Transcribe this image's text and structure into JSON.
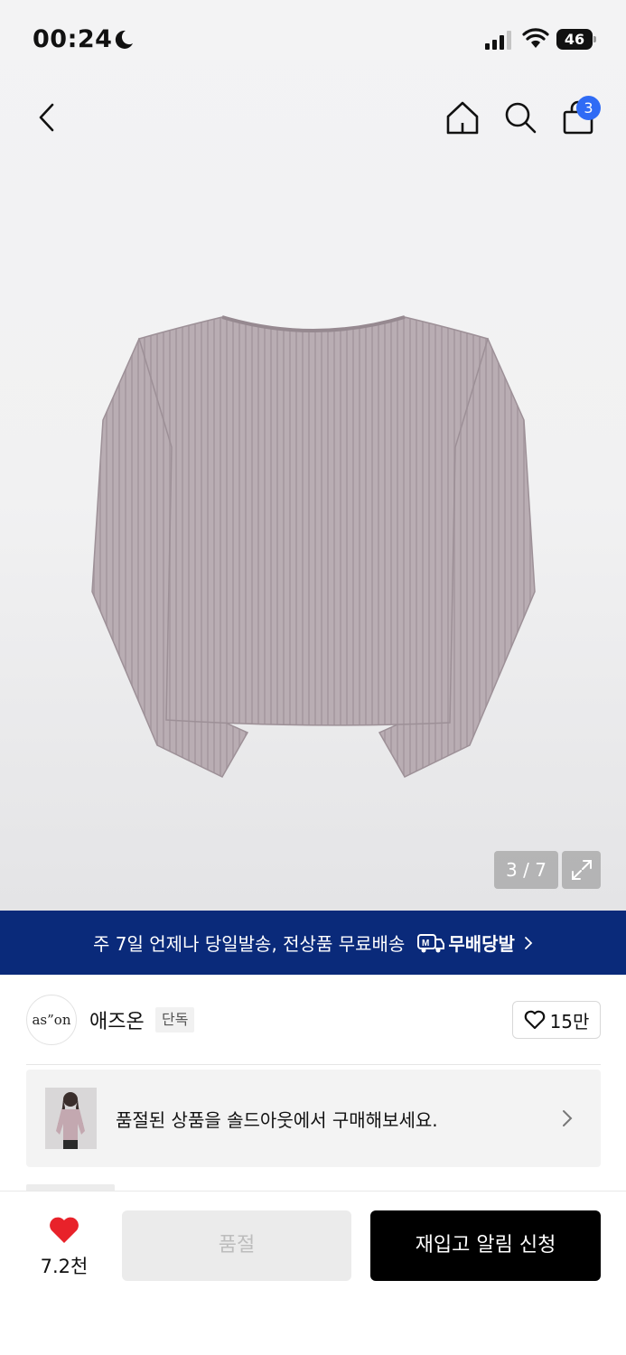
{
  "status_bar": {
    "time": "00:24",
    "battery": "46"
  },
  "nav": {
    "back_icon": "chevron-left-icon",
    "home_icon": "home-icon",
    "search_icon": "search-icon",
    "cart_icon": "shopping-bag-icon",
    "cart_count": "3"
  },
  "gallery": {
    "counter": "3 / 7",
    "expand_icon": "expand-icon",
    "product_color": "#b6aab0"
  },
  "banner": {
    "text": "주 7일 언제나 당일발송, 전상품 무료배송",
    "logo_text": "무배당발",
    "background": "#0a2a7a"
  },
  "brand": {
    "logo_text": "as”on",
    "name": "애즈온",
    "tag": "단독",
    "likes": "15만"
  },
  "promo": {
    "text": "품절된 상품을 솔드아웃에서 구매해보세요."
  },
  "bottom": {
    "fav_count": "7.2천",
    "soldout_label": "품절",
    "restock_label": "재입고 알림 신청",
    "heart_color": "#e8222a"
  }
}
